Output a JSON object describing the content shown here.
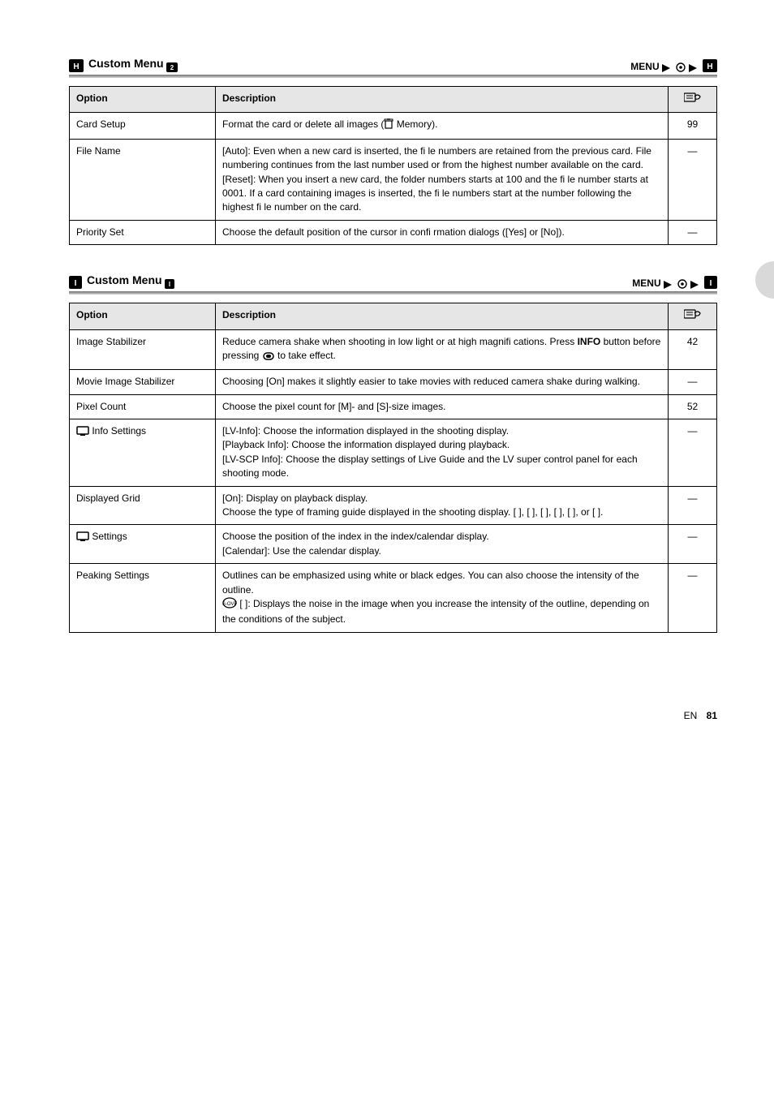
{
  "sections": [
    {
      "icon": "H2",
      "name": "Custom Menu ",
      "suffix": "2",
      "menu_label": "MENU",
      "icon_label": "2",
      "header_option": "Option",
      "header_desc": "Description",
      "header_pg_icon": "hand-icon",
      "rows": [
        {
          "option": "Card Setup",
          "desc_parts": [
            "Format the card or delete all images (",
            " Memory).",
            ""
          ],
          "pg": "99",
          "icons": [
            "trash"
          ]
        },
        {
          "option": "File Name",
          "desc_lines": [
            "[Auto]: Even when a new card is inserted, the fi le numbers are retained from the previous card. File numbering continues from the last number used or from the highest number available on the card.",
            "[Reset]: When you insert a new card, the folder numbers starts at 100 and the fi le number starts at 0001. If a card containing images is inserted, the fi le numbers start at the number following the highest fi le number on the card."
          ],
          "pg": "—"
        },
        {
          "option": "Priority Set",
          "desc": "Choose the default position of the cursor in confi rmation dialogs ([Yes] or [No]).",
          "pg": "—"
        }
      ]
    },
    {
      "icon": "I",
      "name": "Custom Menu ",
      "suffix": "",
      "menu_label": "MENU",
      "icon_label": "",
      "header_option": "Option",
      "header_desc": "Description",
      "header_pg_icon": "hand-icon",
      "rows": [
        {
          "option": "Image Stabilizer",
          "desc_parts": [
            "Reduce camera shake when shooting in low light or at high magnifi cations. Press ",
            " button before pressing ",
            " to take effect."
          ],
          "pg": "42",
          "icons": [
            "shutter",
            "INFO"
          ]
        },
        {
          "option": "Movie Image Stabilizer",
          "desc": "Choosing [On] makes it slightly easier to take movies with reduced camera shake during walking.",
          "pg": "—"
        },
        {
          "option": "Pixel Count",
          "desc": "Choose the pixel count for [M]- and [S]-size images.",
          "pg": "52"
        },
        {
          "option_icon": "monitor",
          "option": "Info Settings",
          "desc_lines": [
            "[LV-Info]: Choose the information displayed in the shooting display.",
            "[Playback Info]: Choose the information displayed during playback.",
            "[LV-SCP Info]: Choose the display settings of Live Guide and the LV super control panel for each shooting mode."
          ],
          "pg": "—"
        },
        {
          "option": "Displayed Grid",
          "desc_lines": [
            "[On]: Display on playback display.",
            "Choose the type of framing guide displayed in the shooting display. [ ], [ ], [ ], [ ], [ ], or [ ]."
          ],
          "pg": "—"
        },
        {
          "option_icon": "monitor",
          "option": "Settings",
          "desc_lines": [
            "Choose the position of the index in the index/calendar display.",
            "[Calendar]: Use the calendar display."
          ],
          "pg": "—"
        },
        {
          "option": "Peaking Settings",
          "desc_lines": [
            "Outlines can be emphasized using white or black edges. You can also choose the intensity of the outline.",
            "[ ]: Displays the noise in the image when you increase the intensity of the outline, depending on the conditions of the subject."
          ],
          "pg": "—"
        }
      ]
    }
  ],
  "footer": {
    "label": "EN",
    "page": "81"
  }
}
